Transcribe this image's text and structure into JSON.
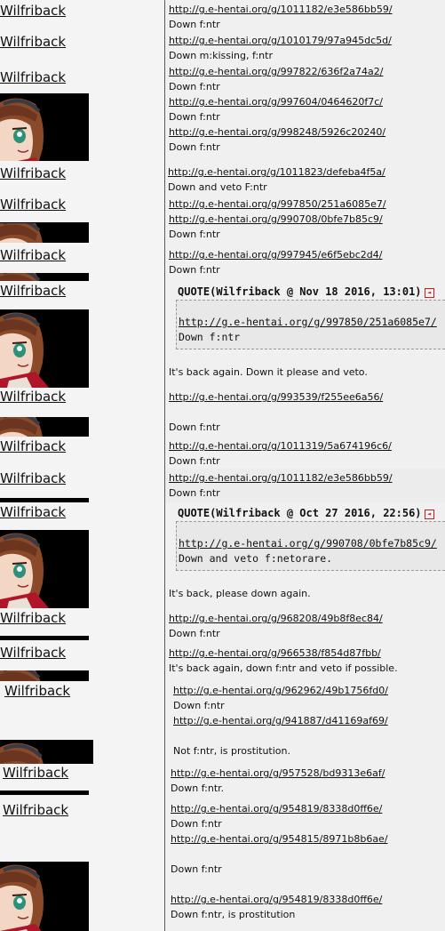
{
  "username": "Wilfriback",
  "posts": [
    {
      "lines": [
        "http://g.e-hentai.org/g/1011182/e3e586bb59/",
        "Down f:ntr"
      ]
    },
    {
      "lines": [
        "http://g.e-hentai.org/g/1010179/97a945dc5d/",
        "Down m:kissing, f:ntr"
      ]
    },
    {
      "lines": [
        "http://g.e-hentai.org/g/997822/636f2a74a2/",
        "Down f:ntr",
        "http://g.e-hentai.org/g/997604/0464620f7c/",
        "Down f:ntr",
        "http://g.e-hentai.org/g/998248/5926c20240/",
        "Down f:ntr"
      ]
    },
    {
      "lines": [
        "http://g.e-hentai.org/g/1011823/defeba4f5a/",
        "Down and veto F:ntr"
      ]
    },
    {
      "lines": [
        "http://g.e-hentai.org/g/997850/251a6085e7/",
        "http://g.e-hentai.org/g/990708/0bfe7b85c9/",
        "Down f:ntr"
      ]
    },
    {
      "lines": [
        "http://g.e-hentai.org/g/997945/e6f5ebc2d4/",
        "Down f:ntr"
      ]
    },
    {
      "quote_header": "QUOTE(Wilfriback @ Nov 18 2016, 13:01)",
      "quote_lines": [
        "http://g.e-hentai.org/g/997850/251a6085e7/",
        "Down f:ntr"
      ],
      "after": "It's back again. Down it please and veto."
    },
    {
      "lines": [
        "http://g.e-hentai.org/g/993539/f255ee6a56/",
        "",
        "Down f:ntr"
      ]
    },
    {
      "lines": [
        "http://g.e-hentai.org/g/1011319/5a674196c6/",
        "Down f:ntr"
      ]
    },
    {
      "lines": [
        "http://g.e-hentai.org/g/1011182/e3e586bb59/",
        "Down f:ntr"
      ]
    },
    {
      "quote_header": "QUOTE(Wilfriback @ Oct 27 2016, 22:56)",
      "quote_lines": [
        "http://g.e-hentai.org/g/990708/0bfe7b85c9/",
        "Down and veto f:netorare."
      ],
      "after": "It's back, please down again."
    },
    {
      "lines": [
        "http://g.e-hentai.org/g/968208/49b8f8ec84/",
        "Down f:ntr"
      ]
    },
    {
      "lines": [
        "http://g.e-hentai.org/g/966538/f854d87fbb/",
        "It's back again, down f:ntr and veto if possible."
      ]
    },
    {
      "lines": [
        "http://g.e-hentai.org/g/962962/49b1756fd0/",
        "Down f:ntr",
        "http://g.e-hentai.org/g/941887/d41169af69/",
        "",
        "Not f:ntr, is prostitution."
      ]
    },
    {
      "lines": [
        "http://g.e-hentai.org/g/957528/bd9313e6af/",
        "Down f:ntr."
      ]
    },
    {
      "lines": [
        "http://g.e-hentai.org/g/954819/8338d0ff6e/",
        "Down f:ntr",
        "http://g.e-hentai.org/g/954815/8971b8b6ae/",
        "",
        "Down f:ntr",
        "",
        "http://g.e-hentai.org/g/954819/8338d0ff6e/",
        "Down f:ntr, is prostitution"
      ]
    }
  ]
}
